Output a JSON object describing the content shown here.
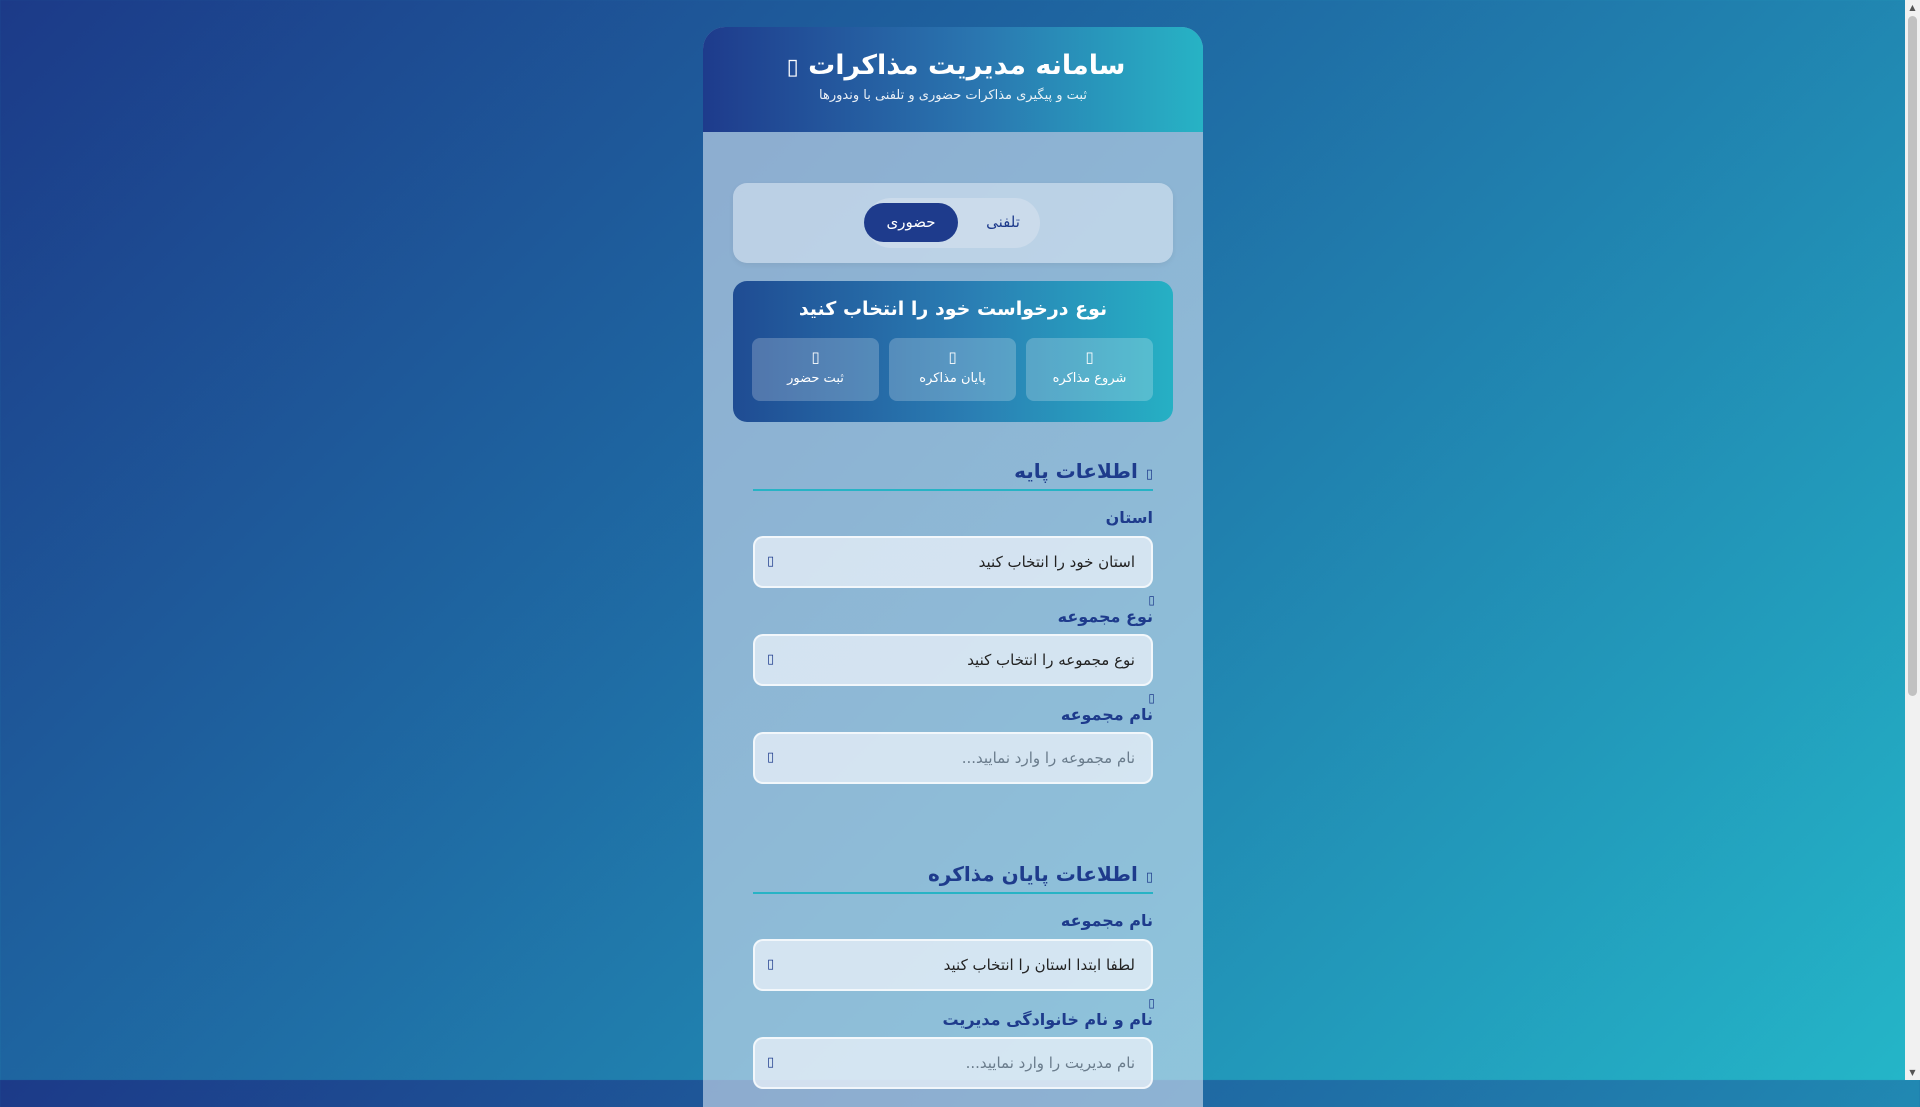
{
  "header": {
    "title": "سامانه مدیریت مذاکرات",
    "title_icon": "▯",
    "subtitle": "ثبت و پیگیری مذاکرات حضوری و تلفنی با وندورها"
  },
  "mode_toggle": {
    "active_label": "حضوری",
    "inactive_label": "تلفنی"
  },
  "request": {
    "title": "نوع درخواست خود را انتخاب کنید",
    "buttons": [
      {
        "label": "شروع مذاکره",
        "icon": "▯"
      },
      {
        "label": "پایان مذاکره",
        "icon": "▯"
      },
      {
        "label": "ثبت حضور",
        "icon": "▯"
      }
    ]
  },
  "basic_info": {
    "title": "اطلاعات پایه",
    "title_icon": "▯",
    "province_label": "استان",
    "province_value": "استان خود را انتخاب کنید",
    "collection_type_label": "نوع مجموعه",
    "collection_type_value": "نوع مجموعه را انتخاب کنید",
    "collection_name_label": "نام مجموعه",
    "collection_name_placeholder": "نام مجموعه را وارد نمایید...",
    "field_icon": "▯",
    "label_mark": "▯"
  },
  "end_info": {
    "title": "اطلاعات پایان مذاکره",
    "title_icon": "▯",
    "collection_name_label": "نام مجموعه",
    "collection_name_value": "لطفا ابتدا استان را انتخاب کنید",
    "manager_label": "نام و نام خانوادگی مدیریت",
    "manager_placeholder": "نام مدیریت را وارد نمایید...",
    "field_icon": "▯",
    "label_mark": "▯"
  },
  "colors": {
    "primary": "#1e3b8c",
    "accent": "#27b3c5"
  }
}
